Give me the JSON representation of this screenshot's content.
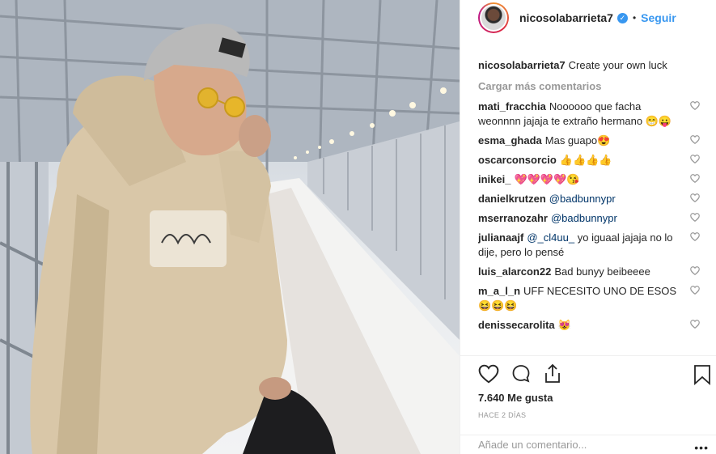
{
  "post": {
    "username": "nicosolabarrieta7",
    "verified_icon": "verified-badge-icon",
    "separator": "•",
    "follow_label": "Seguir",
    "caption": "Create your own luck",
    "load_more": "Cargar más comentarios",
    "likes": "7.640 Me gusta",
    "time": "HACE 2 DÍAS",
    "comment_placeholder": "Añade un comentario...",
    "more_options": "•••"
  },
  "comments": [
    {
      "user": "mati_fracchia",
      "text": "Noooooo que facha weonnnn jajaja te extraño hermano 😁😛"
    },
    {
      "user": "esma_ghada",
      "text": "Mas guapo😍"
    },
    {
      "user": "oscarconsorcio",
      "text": "👍👍👍👍"
    },
    {
      "user": "inikei_",
      "text": "💖💖💖💖😘"
    },
    {
      "user": "danielkrutzen",
      "mention": "@badbunnypr",
      "text": ""
    },
    {
      "user": "mserranozahr",
      "mention": "@badbunnypr",
      "text": ""
    },
    {
      "user": "julianaajf",
      "mention": "@_cl4uu_",
      "text": " yo iguaal jajaja no lo dije, pero lo pensé"
    },
    {
      "user": "luis_alarcon22",
      "text": "Bad bunyy beibeeee"
    },
    {
      "user": "m_a_l_n",
      "text": "UFF NECESITO UNO DE ESOS 😆😆😆"
    },
    {
      "user": "denissecarolita",
      "text": "😻"
    }
  ],
  "icons": {
    "like": "heart-icon",
    "comment": "comment-bubble-icon",
    "share": "share-icon",
    "save": "bookmark-icon"
  }
}
